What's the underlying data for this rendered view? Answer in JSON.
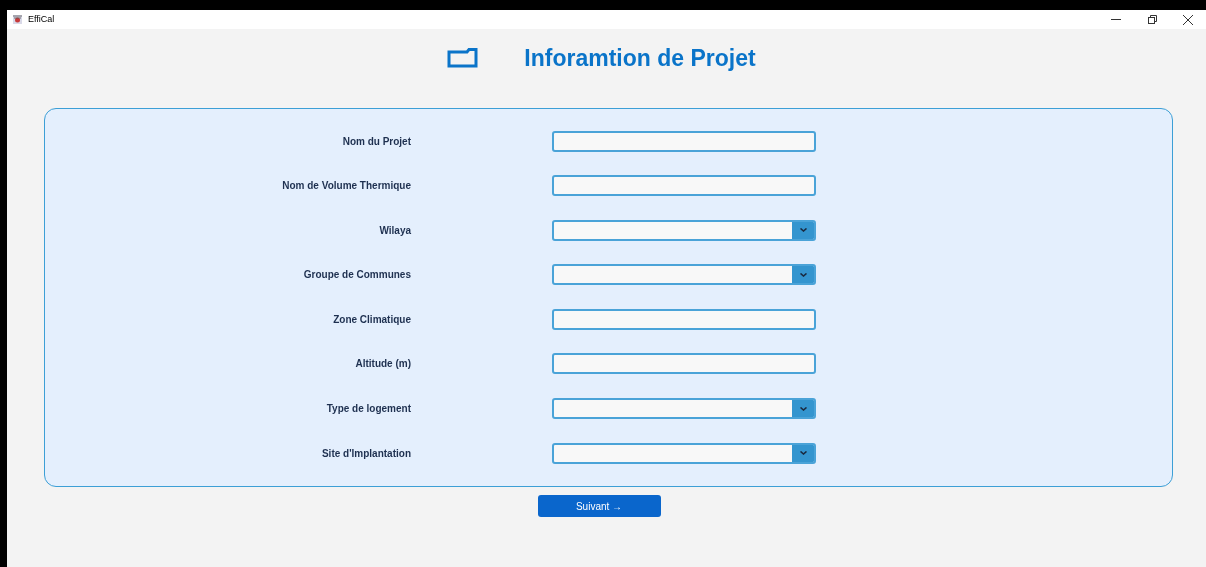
{
  "window": {
    "title": "EffiCal"
  },
  "heading": "Inforamtion de Projet",
  "fields": [
    {
      "label": "Nom du Projet",
      "kind": "text"
    },
    {
      "label": "Nom de Volume Thermique",
      "kind": "text"
    },
    {
      "label": "Wilaya",
      "kind": "select"
    },
    {
      "label": "Groupe de Communes",
      "kind": "select"
    },
    {
      "label": "Zone Climatique",
      "kind": "text"
    },
    {
      "label": "Altitude (m)",
      "kind": "text"
    },
    {
      "label": "Type de logement",
      "kind": "select"
    },
    {
      "label": "Site d'Implantation",
      "kind": "select"
    }
  ],
  "next_button": "Suivant →"
}
